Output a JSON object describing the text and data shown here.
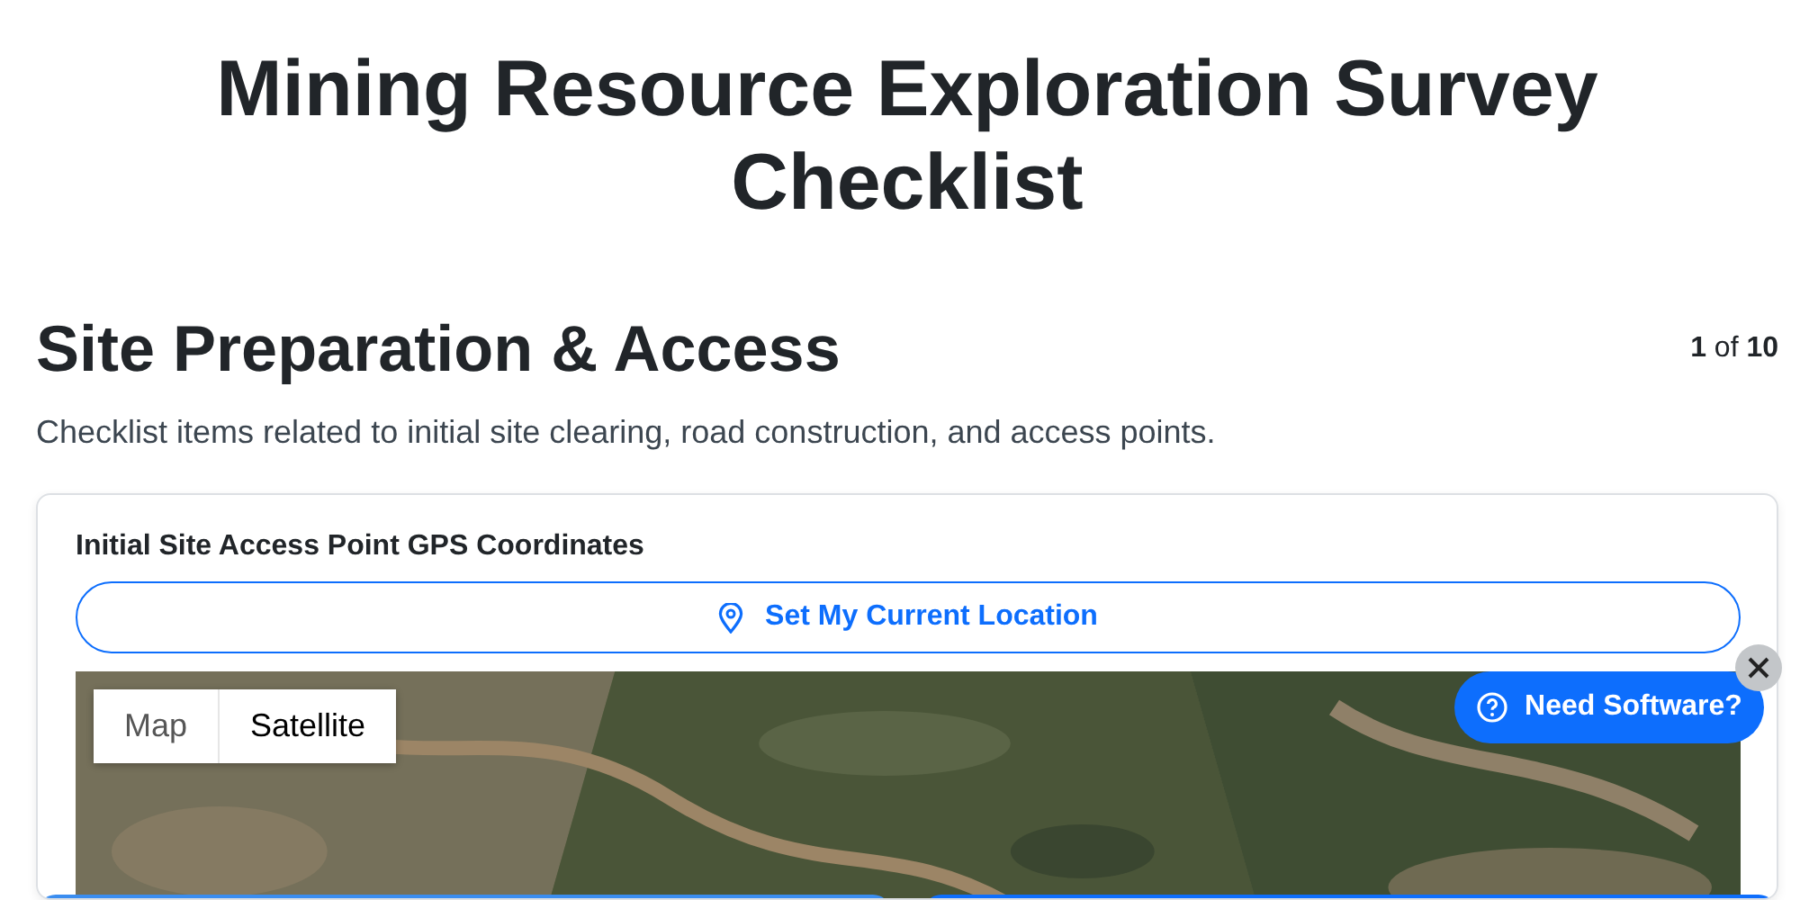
{
  "title": "Mining Resource Exploration Survey Checklist",
  "section": {
    "heading": "Site Preparation & Access",
    "progress": "**1** of **10**",
    "description": "Checklist items related to initial site clearing, road construction, and access points."
  },
  "field": {
    "label": "Initial Site Access Point GPS Coordinates",
    "location_button": "Set My Current Location",
    "map": {
      "tabs": [
        {
          "label": "Map",
          "selected": false
        },
        {
          "label": "Satellite",
          "selected": true
        }
      ]
    }
  },
  "bottom_buttons": [
    {
      "kind": "secondary"
    },
    {
      "kind": "primary"
    }
  ],
  "help": {
    "label": "Need Software?"
  }
}
